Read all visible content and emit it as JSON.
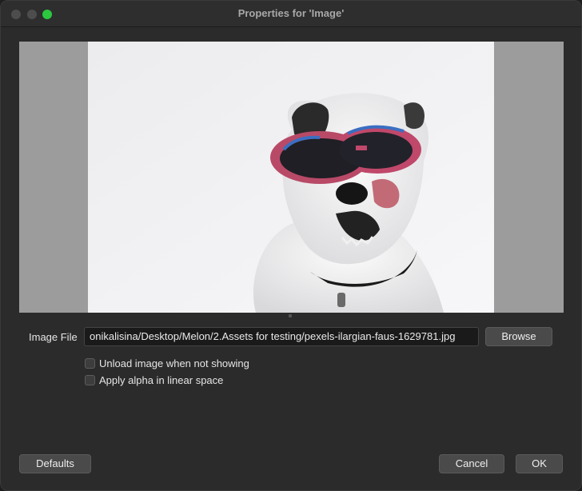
{
  "window": {
    "title": "Properties for 'Image'"
  },
  "preview": {
    "image_description_icon": "image-preview"
  },
  "form": {
    "image_file_label": "Image File",
    "image_file_value": "onikalisina/Desktop/Melon/2.Assets for testing/pexels-ilargian-faus-1629781.jpg",
    "browse_label": "Browse",
    "checkboxes": [
      {
        "label": "Unload image when not showing",
        "checked": false
      },
      {
        "label": "Apply alpha in linear space",
        "checked": false
      }
    ]
  },
  "footer": {
    "defaults_label": "Defaults",
    "cancel_label": "Cancel",
    "ok_label": "OK"
  },
  "colors": {
    "window_bg": "#2b2b2b",
    "preview_bg": "#9c9c9c",
    "zoom_button": "#2bc840"
  }
}
